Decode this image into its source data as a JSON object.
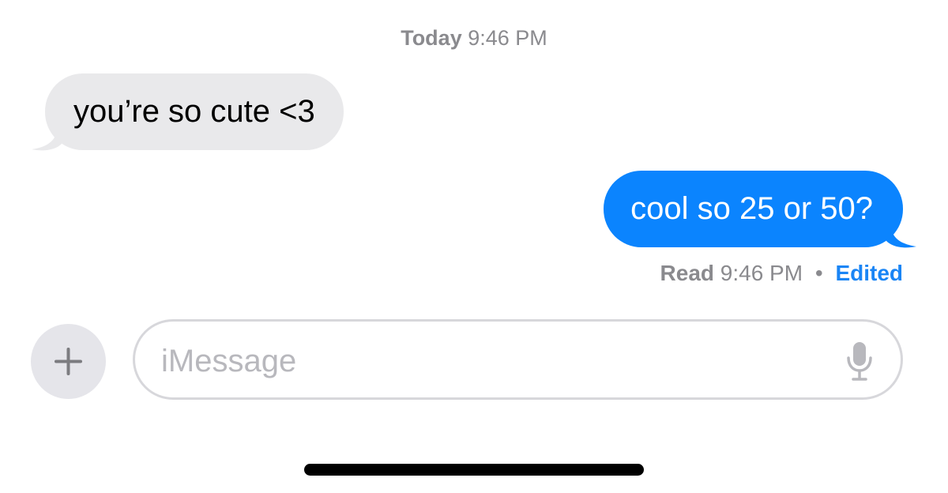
{
  "header": {
    "day": "Today",
    "time": "9:46 PM"
  },
  "messages": [
    {
      "direction": "incoming",
      "text": "you’re so cute <3"
    },
    {
      "direction": "outgoing",
      "text": "cool so 25 or 50?"
    }
  ],
  "receipt": {
    "read_label": "Read",
    "time": "9:46 PM",
    "separator": "•",
    "edited_label": "Edited"
  },
  "composer": {
    "placeholder": "iMessage",
    "plus_icon": "plus-icon",
    "mic_icon": "microphone-icon"
  },
  "colors": {
    "incoming_bubble": "#e9e9eb",
    "outgoing_bubble": "#0b84fe",
    "edited_text": "#1a85f5",
    "meta_text": "#8a8a8e"
  }
}
